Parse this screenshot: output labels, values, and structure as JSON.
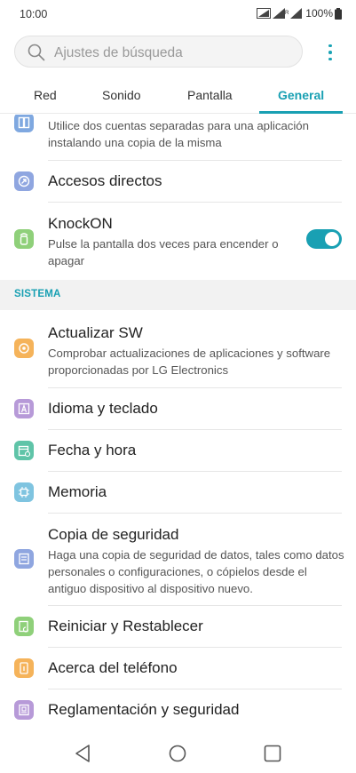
{
  "status": {
    "time": "10:00",
    "battery": "100%"
  },
  "search": {
    "placeholder": "Ajustes de búsqueda"
  },
  "tabs": [
    {
      "label": "Red"
    },
    {
      "label": "Sonido"
    },
    {
      "label": "Pantalla"
    },
    {
      "label": "General",
      "active": true
    }
  ],
  "items": {
    "dual_app": {
      "subtitle": "Utilice dos cuentas separadas para una aplicación instalando una copia de la misma"
    },
    "shortcuts": {
      "title": "Accesos directos"
    },
    "knockon": {
      "title": "KnockON",
      "subtitle": "Pulse la pantalla dos veces para encender o apagar",
      "enabled": true
    },
    "section_system": "SISTEMA",
    "update_sw": {
      "title": "Actualizar SW",
      "subtitle": "Comprobar actualizaciones de aplicaciones y software proporcionadas por LG Electronics"
    },
    "language": {
      "title": "Idioma y teclado"
    },
    "date_time": {
      "title": "Fecha y hora"
    },
    "memory": {
      "title": "Memoria"
    },
    "backup": {
      "title": "Copia de seguridad",
      "subtitle": "Haga una copia de seguridad de datos, tales como datos personales o configuraciones, o cópielos desde el antiguo dispositivo al dispositivo nuevo."
    },
    "reset": {
      "title": "Reiniciar y Restablecer"
    },
    "about": {
      "title": "Acerca del teléfono"
    },
    "regulatory": {
      "title": "Reglamentación y seguridad"
    }
  },
  "colors": {
    "accent": "#19a0b3",
    "icon_blue": "#7fa8e0",
    "icon_green": "#8fd07a",
    "icon_orange": "#f5b35a",
    "icon_purple": "#b79ad8",
    "icon_teal": "#5fc4a8"
  },
  "icons": {
    "dual_app": "dual-app-icon",
    "shortcuts": "shortcut-icon",
    "knockon": "knock-icon",
    "update_sw": "update-icon",
    "language": "language-icon",
    "date_time": "calendar-icon",
    "memory": "memory-chip-icon",
    "backup": "backup-icon",
    "reset": "reset-icon",
    "about": "phone-info-icon",
    "regulatory": "regulatory-icon"
  }
}
